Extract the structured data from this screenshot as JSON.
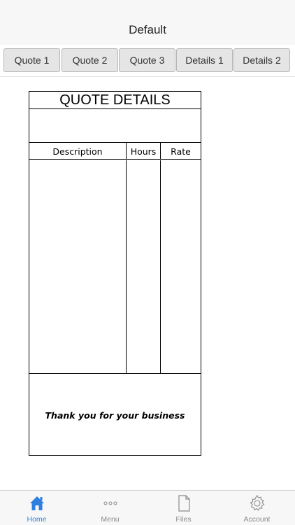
{
  "header": {
    "title": "Default"
  },
  "tabs": [
    {
      "label": "Quote 1"
    },
    {
      "label": "Quote 2"
    },
    {
      "label": "Quote 3"
    },
    {
      "label": "Details 1"
    },
    {
      "label": "Details 2"
    }
  ],
  "quote": {
    "title": "QUOTE DETAILS",
    "columns": [
      "Description",
      "Hours",
      "Rate"
    ],
    "footer_text": "Thank you for your business"
  },
  "tab_bar": {
    "items": [
      {
        "label": "Home",
        "icon": "home-icon",
        "active": true
      },
      {
        "label": "Menu",
        "icon": "more-icon",
        "active": false
      },
      {
        "label": "Files",
        "icon": "file-icon",
        "active": false
      },
      {
        "label": "Account",
        "icon": "gear-icon",
        "active": false
      }
    ]
  },
  "colors": {
    "accent": "#2f7fe0",
    "bar_background": "#f7f7f7",
    "tab_background": "#e5e5e5",
    "inactive_label": "#8a8a8a"
  }
}
